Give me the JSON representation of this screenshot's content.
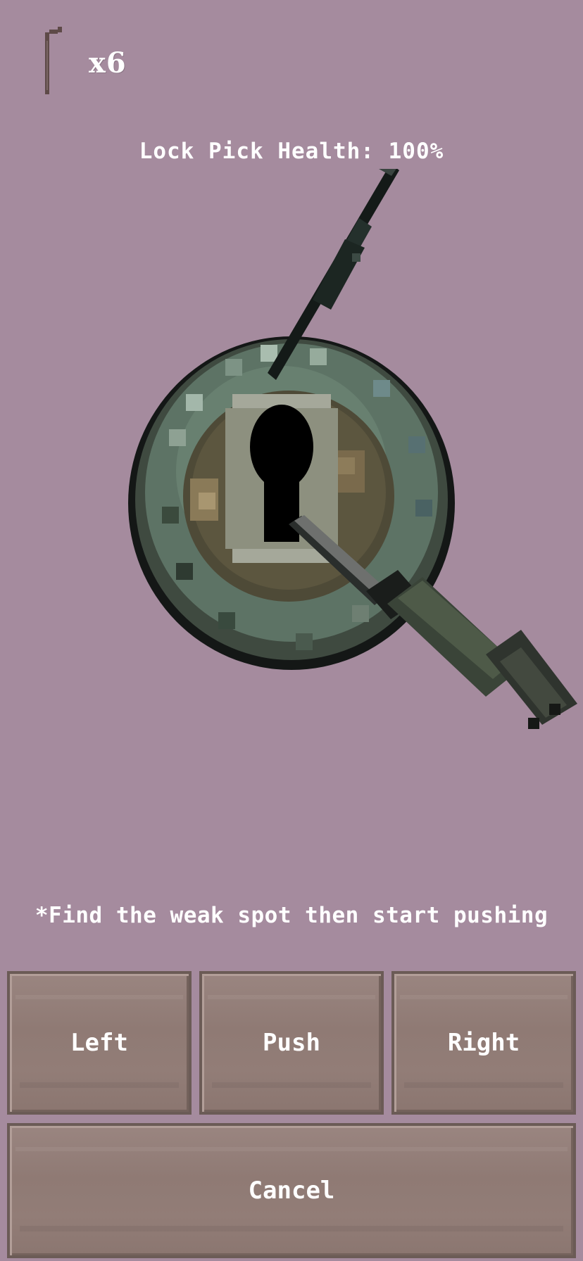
{
  "hud": {
    "pick_count": "x6",
    "health_label": "Lock Pick Health: 100%"
  },
  "hint": "*Find the weak spot then start pushing",
  "controls": {
    "left": "Left",
    "push": "Push",
    "right": "Right",
    "cancel": "Cancel"
  },
  "icons": {
    "pick_icon": "lockpick-icon",
    "lock": "keyhole-lock",
    "lockpick": "lockpick",
    "tension_wrench": "tension-wrench"
  },
  "colors": {
    "background": "#a58b9e",
    "button": "#918079",
    "text": "#ffffff"
  }
}
